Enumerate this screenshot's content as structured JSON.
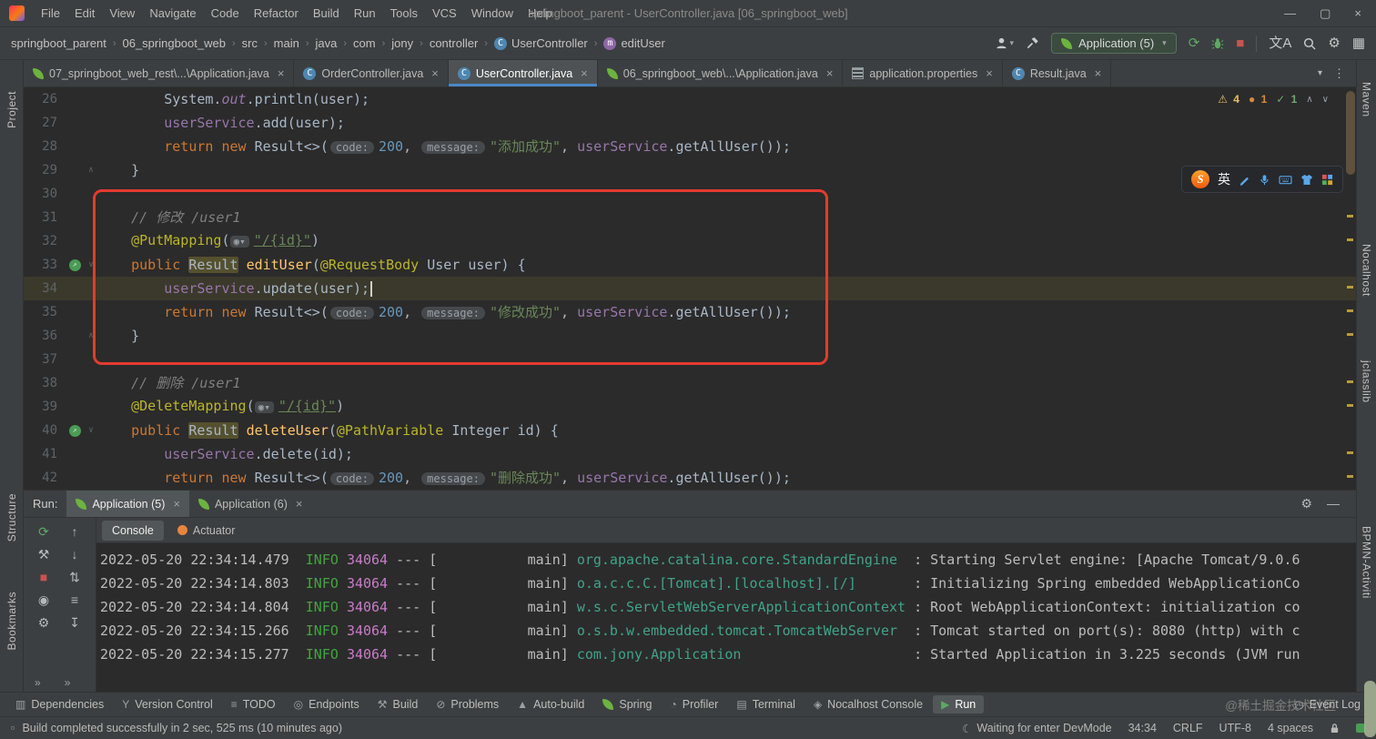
{
  "window": {
    "title": "springboot_parent - UserController.java [06_springboot_web]",
    "menus": [
      "File",
      "Edit",
      "View",
      "Navigate",
      "Code",
      "Refactor",
      "Build",
      "Run",
      "Tools",
      "VCS",
      "Window",
      "Help"
    ],
    "controls": {
      "minimize": "—",
      "maximize": "▢",
      "close": "×"
    }
  },
  "breadcrumbs": [
    {
      "label": "springboot_parent"
    },
    {
      "label": "06_springboot_web"
    },
    {
      "label": "src"
    },
    {
      "label": "main"
    },
    {
      "label": "java"
    },
    {
      "label": "com"
    },
    {
      "label": "jony"
    },
    {
      "label": "controller"
    },
    {
      "label": "UserController",
      "icon": "class"
    },
    {
      "label": "editUser",
      "icon": "method"
    }
  ],
  "nav_toolbar": {
    "run_config": "Application (5)",
    "translate_label": "文A"
  },
  "editor_tabs": [
    {
      "label": "07_springboot_web_rest\\...\\Application.java",
      "icon": "spring",
      "active": false
    },
    {
      "label": "OrderController.java",
      "icon": "class",
      "active": false
    },
    {
      "label": "UserController.java",
      "icon": "class",
      "active": true
    },
    {
      "label": "06_springboot_web\\...\\Application.java",
      "icon": "spring",
      "active": false
    },
    {
      "label": "application.properties",
      "icon": "props",
      "active": false
    },
    {
      "label": "Result.java",
      "icon": "class",
      "active": false
    }
  ],
  "tabs_extra": {
    "dropdown": "▾",
    "more": "⋮"
  },
  "inspections": {
    "warnings": "4",
    "typos": "1",
    "ok": "1",
    "prev": "∧",
    "next": "∨"
  },
  "ime": {
    "logo": "S",
    "lang": "英"
  },
  "left_strip": [
    {
      "label": "Project"
    },
    {
      "label": "Structure"
    },
    {
      "label": "Bookmarks"
    }
  ],
  "right_strip": [
    {
      "label": "Maven"
    },
    {
      "label": "Nocalhost"
    },
    {
      "label": "jclasslib"
    },
    {
      "label": "BPMN-Activiti"
    }
  ],
  "editor": {
    "lines": [
      {
        "num": 26,
        "tokens": [
          {
            "t": "        ",
            "c": "p"
          },
          {
            "t": "System.",
            "c": "p"
          },
          {
            "t": "out",
            "c": "fi"
          },
          {
            "t": ".println(user);",
            "c": "p"
          }
        ]
      },
      {
        "num": 27,
        "tokens": [
          {
            "t": "        ",
            "c": "p"
          },
          {
            "t": "userService",
            "c": "f"
          },
          {
            "t": ".add(user);",
            "c": "p"
          }
        ]
      },
      {
        "num": 28,
        "tokens": [
          {
            "t": "        ",
            "c": "p"
          },
          {
            "t": "return ",
            "c": "k"
          },
          {
            "t": "new ",
            "c": "k"
          },
          {
            "t": "Result<>(",
            "c": "p"
          },
          {
            "t": "code:",
            "c": "h"
          },
          {
            "t": "200",
            "c": "n"
          },
          {
            "t": ", ",
            "c": "p"
          },
          {
            "t": "message:",
            "c": "h"
          },
          {
            "t": "\"添加成功\"",
            "c": "s"
          },
          {
            "t": ", ",
            "c": "p"
          },
          {
            "t": "userService",
            "c": "f"
          },
          {
            "t": ".getAllUser());",
            "c": "p"
          }
        ]
      },
      {
        "num": 29,
        "fold": "∧",
        "tokens": [
          {
            "t": "    }",
            "c": "p"
          }
        ]
      },
      {
        "num": 30,
        "tokens": []
      },
      {
        "num": 31,
        "tokens": [
          {
            "t": "    ",
            "c": "p"
          },
          {
            "t": "// 修改 /user1",
            "c": "c"
          }
        ]
      },
      {
        "num": 32,
        "tokens": [
          {
            "t": "    ",
            "c": "p"
          },
          {
            "t": "@PutMapping",
            "c": "a"
          },
          {
            "t": "(",
            "c": "p"
          },
          {
            "t": "◉▾",
            "c": "mi"
          },
          {
            "t": "\"/{id}\"",
            "c": "sl"
          },
          {
            "t": ")",
            "c": "p"
          }
        ]
      },
      {
        "num": 33,
        "icon": "mapping",
        "fold": "∨",
        "tokens": [
          {
            "t": "    ",
            "c": "p"
          },
          {
            "t": "public ",
            "c": "k"
          },
          {
            "t": "Result",
            "c": "hl"
          },
          {
            "t": " ",
            "c": "p"
          },
          {
            "t": "editUser",
            "c": "m"
          },
          {
            "t": "(",
            "c": "p"
          },
          {
            "t": "@RequestBody",
            "c": "a"
          },
          {
            "t": " User user) {",
            "c": "p"
          }
        ]
      },
      {
        "num": 34,
        "current": true,
        "tokens": [
          {
            "t": "        ",
            "c": "p"
          },
          {
            "t": "userService",
            "c": "f"
          },
          {
            "t": ".update(user);",
            "c": "p"
          },
          {
            "t": "",
            "c": "caret"
          }
        ]
      },
      {
        "num": 35,
        "tokens": [
          {
            "t": "        ",
            "c": "p"
          },
          {
            "t": "return ",
            "c": "k"
          },
          {
            "t": "new ",
            "c": "k"
          },
          {
            "t": "Result<>(",
            "c": "p"
          },
          {
            "t": "code:",
            "c": "h"
          },
          {
            "t": "200",
            "c": "n"
          },
          {
            "t": ", ",
            "c": "p"
          },
          {
            "t": "message:",
            "c": "h"
          },
          {
            "t": "\"修改成功\"",
            "c": "s"
          },
          {
            "t": ", ",
            "c": "p"
          },
          {
            "t": "userService",
            "c": "f"
          },
          {
            "t": ".getAllUser());",
            "c": "p"
          }
        ]
      },
      {
        "num": 36,
        "fold": "∧",
        "tokens": [
          {
            "t": "    }",
            "c": "p"
          }
        ]
      },
      {
        "num": 37,
        "tokens": []
      },
      {
        "num": 38,
        "tokens": [
          {
            "t": "    ",
            "c": "p"
          },
          {
            "t": "// 删除 /user1",
            "c": "c"
          }
        ]
      },
      {
        "num": 39,
        "tokens": [
          {
            "t": "    ",
            "c": "p"
          },
          {
            "t": "@DeleteMapping",
            "c": "a"
          },
          {
            "t": "(",
            "c": "p"
          },
          {
            "t": "◉▾",
            "c": "mi"
          },
          {
            "t": "\"/{id}\"",
            "c": "sl"
          },
          {
            "t": ")",
            "c": "p"
          }
        ]
      },
      {
        "num": 40,
        "icon": "mapping",
        "fold": "∨",
        "tokens": [
          {
            "t": "    ",
            "c": "p"
          },
          {
            "t": "public ",
            "c": "k"
          },
          {
            "t": "Result",
            "c": "hl"
          },
          {
            "t": " ",
            "c": "p"
          },
          {
            "t": "deleteUser",
            "c": "m"
          },
          {
            "t": "(",
            "c": "p"
          },
          {
            "t": "@PathVariable",
            "c": "a"
          },
          {
            "t": " Integer id) {",
            "c": "p"
          }
        ]
      },
      {
        "num": 41,
        "tokens": [
          {
            "t": "        ",
            "c": "p"
          },
          {
            "t": "userService",
            "c": "f"
          },
          {
            "t": ".delete(id);",
            "c": "p"
          }
        ]
      },
      {
        "num": 42,
        "tokens": [
          {
            "t": "        ",
            "c": "p"
          },
          {
            "t": "return ",
            "c": "k"
          },
          {
            "t": "new ",
            "c": "k"
          },
          {
            "t": "Result<>(",
            "c": "p"
          },
          {
            "t": "code:",
            "c": "h"
          },
          {
            "t": "200",
            "c": "n"
          },
          {
            "t": ", ",
            "c": "p"
          },
          {
            "t": "message:",
            "c": "h"
          },
          {
            "t": "\"删除成功\"",
            "c": "s"
          },
          {
            "t": ", ",
            "c": "p"
          },
          {
            "t": "userService",
            "c": "f"
          },
          {
            "t": ".getAllUser());",
            "c": "p"
          }
        ]
      }
    ]
  },
  "run_panel": {
    "label": "Run:",
    "tabs": [
      {
        "label": "Application (5)",
        "active": true
      },
      {
        "label": "Application (6)",
        "active": false
      }
    ],
    "header_icons": {
      "settings": "⚙",
      "hide": "—"
    },
    "console_tabs": [
      {
        "label": "Console",
        "active": true
      },
      {
        "label": "Actuator",
        "icon": "actuator",
        "active": false
      }
    ],
    "toolbar": {
      "col1": [
        {
          "n": "rerun-icon",
          "g": "⟳",
          "c": "#5fa865"
        },
        {
          "n": "wrench-icon",
          "g": "⚒",
          "c": "#b6b9bb"
        },
        {
          "n": "stop-icon",
          "g": "■",
          "c": "#c75450"
        },
        {
          "n": "screenshot-icon",
          "g": "◉",
          "c": "#b6b9bb"
        },
        {
          "n": "settings-gear-icon",
          "g": "⚙",
          "c": "#b6b9bb"
        }
      ],
      "col2": [
        {
          "n": "up-stack-icon",
          "g": "↑",
          "c": "#b6b9bb"
        },
        {
          "n": "down-stack-icon",
          "g": "↓",
          "c": "#b6b9bb"
        },
        {
          "n": "soft-wrap-icon",
          "g": "⇅",
          "c": "#b6b9bb"
        },
        {
          "n": "list-icon",
          "g": "≡",
          "c": "#b6b9bb"
        },
        {
          "n": "scroll-end-icon",
          "g": "↧",
          "c": "#b6b9bb"
        }
      ],
      "more": "»"
    },
    "console_lines": [
      {
        "tokens": [
          {
            "t": "2022-05-20 22:34:14.479",
            "c": "ts"
          },
          {
            "t": "  ",
            "c": "p"
          },
          {
            "t": "INFO",
            "c": "lvl"
          },
          {
            "t": " ",
            "c": "p"
          },
          {
            "t": "34064",
            "c": "pid"
          },
          {
            "t": " --- [           main] ",
            "c": "p"
          },
          {
            "t": "org.apache.catalina.core.StandardEngine ",
            "c": "lg"
          },
          {
            "t": " : ",
            "c": "p"
          },
          {
            "t": "Starting Servlet engine: [Apache Tomcat/9.0.6",
            "c": "msg"
          }
        ]
      },
      {
        "tokens": [
          {
            "t": "2022-05-20 22:34:14.803",
            "c": "ts"
          },
          {
            "t": "  ",
            "c": "p"
          },
          {
            "t": "INFO",
            "c": "lvl"
          },
          {
            "t": " ",
            "c": "p"
          },
          {
            "t": "34064",
            "c": "pid"
          },
          {
            "t": " --- [           main] ",
            "c": "p"
          },
          {
            "t": "o.a.c.c.C.[Tomcat].[localhost].[/]      ",
            "c": "lg"
          },
          {
            "t": " : ",
            "c": "p"
          },
          {
            "t": "Initializing Spring embedded WebApplicationCo",
            "c": "msg"
          }
        ]
      },
      {
        "tokens": [
          {
            "t": "2022-05-20 22:34:14.804",
            "c": "ts"
          },
          {
            "t": "  ",
            "c": "p"
          },
          {
            "t": "INFO",
            "c": "lvl"
          },
          {
            "t": " ",
            "c": "p"
          },
          {
            "t": "34064",
            "c": "pid"
          },
          {
            "t": " --- [           main] ",
            "c": "p"
          },
          {
            "t": "w.s.c.ServletWebServerApplicationContext",
            "c": "lg"
          },
          {
            "t": " : ",
            "c": "p"
          },
          {
            "t": "Root WebApplicationContext: initialization co",
            "c": "msg"
          }
        ]
      },
      {
        "tokens": [
          {
            "t": "2022-05-20 22:34:15.266",
            "c": "ts"
          },
          {
            "t": "  ",
            "c": "p"
          },
          {
            "t": "INFO",
            "c": "lvl"
          },
          {
            "t": " ",
            "c": "p"
          },
          {
            "t": "34064",
            "c": "pid"
          },
          {
            "t": " --- [           main] ",
            "c": "p"
          },
          {
            "t": "o.s.b.w.embedded.tomcat.TomcatWebServer ",
            "c": "lg"
          },
          {
            "t": " : ",
            "c": "p"
          },
          {
            "t": "Tomcat started on port(s): 8080 (http) with c",
            "c": "msg"
          }
        ]
      },
      {
        "tokens": [
          {
            "t": "2022-05-20 22:34:15.277",
            "c": "ts"
          },
          {
            "t": "  ",
            "c": "p"
          },
          {
            "t": "INFO",
            "c": "lvl"
          },
          {
            "t": " ",
            "c": "p"
          },
          {
            "t": "34064",
            "c": "pid"
          },
          {
            "t": " --- [           main] ",
            "c": "p"
          },
          {
            "t": "com.jony.Application                    ",
            "c": "lg"
          },
          {
            "t": " : ",
            "c": "p"
          },
          {
            "t": "Started Application in 3.225 seconds (JVM run",
            "c": "msg"
          }
        ]
      }
    ]
  },
  "bottom_toolbar": {
    "left": [
      {
        "label": "Dependencies",
        "g": "▥"
      },
      {
        "label": "Version Control",
        "g": "Y"
      },
      {
        "label": "TODO",
        "g": "≡"
      },
      {
        "label": "Endpoints",
        "g": "◎"
      },
      {
        "label": "Build",
        "g": "⚒"
      },
      {
        "label": "Problems",
        "g": "⊘"
      },
      {
        "label": "Auto-build",
        "g": "▲"
      },
      {
        "label": "Spring",
        "g": "leaf"
      },
      {
        "label": "Profiler",
        "g": "◔"
      },
      {
        "label": "Terminal",
        "g": "▤"
      },
      {
        "label": "Nocalhost Console",
        "g": "◈"
      },
      {
        "label": "Run",
        "g": "▶",
        "active": true
      }
    ],
    "right": [
      {
        "label": "Event Log",
        "g": "◷"
      }
    ]
  },
  "statusbar": {
    "message": "Build completed successfully in 2 sec, 525 ms (10 minutes ago)",
    "devmode": "Waiting for enter DevMode",
    "position": "34:34",
    "line_ending": "CRLF",
    "encoding": "UTF-8",
    "indent": "4 spaces"
  },
  "watermark": "@稀土掘金技术社区"
}
